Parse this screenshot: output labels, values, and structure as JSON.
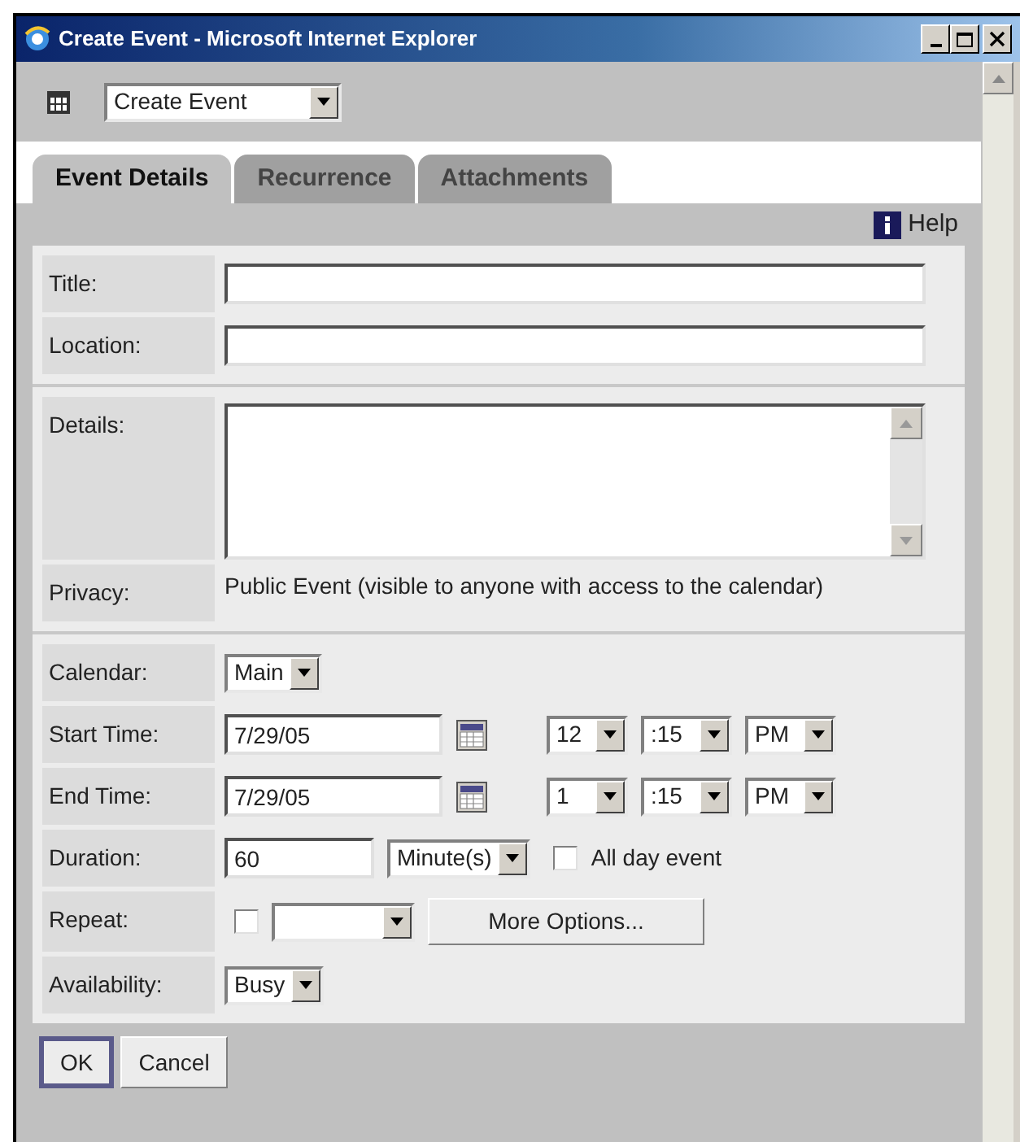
{
  "window": {
    "title": "Create Event - Microsoft Internet Explorer"
  },
  "toolbar": {
    "view_select": "Create Event"
  },
  "tabs": [
    {
      "label": "Event Details",
      "selected": true
    },
    {
      "label": "Recurrence",
      "selected": false
    },
    {
      "label": "Attachments",
      "selected": false
    }
  ],
  "help": "Help",
  "sections": [
    {
      "rows": [
        {
          "kind": "text",
          "label": "Title:"
        },
        {
          "kind": "text",
          "label": "Location:"
        }
      ]
    },
    {
      "rows": [
        {
          "kind": "textarea",
          "label": "Details:"
        },
        {
          "kind": "static",
          "label": "Privacy:",
          "text": "Public Event (visible to anyone with access to the calendar)"
        }
      ]
    },
    {
      "rows": [
        {
          "kind": "select",
          "label": "Calendar:",
          "value": "Main"
        },
        {
          "kind": "datetime",
          "label": "Start Time:",
          "date": "7/29/05",
          "hour": "12",
          "minute": ":15",
          "ampm": "PM"
        },
        {
          "kind": "datetime",
          "label": "End Time:",
          "date": "7/29/05",
          "hour": "1",
          "minute": ":15",
          "ampm": "PM"
        },
        {
          "kind": "duration",
          "label": "Duration:",
          "value": "60",
          "unit": "Minute(s)",
          "all_day": {
            "label": "All day event",
            "checked": false
          }
        },
        {
          "kind": "repeat",
          "label": "Repeat:",
          "checked": false,
          "button": "More Options..."
        },
        {
          "kind": "select",
          "label": "Availability:",
          "value": "Busy"
        }
      ]
    }
  ],
  "buttons": [
    {
      "label": "OK",
      "focused": true
    },
    {
      "label": "Cancel",
      "focused": false
    }
  ]
}
